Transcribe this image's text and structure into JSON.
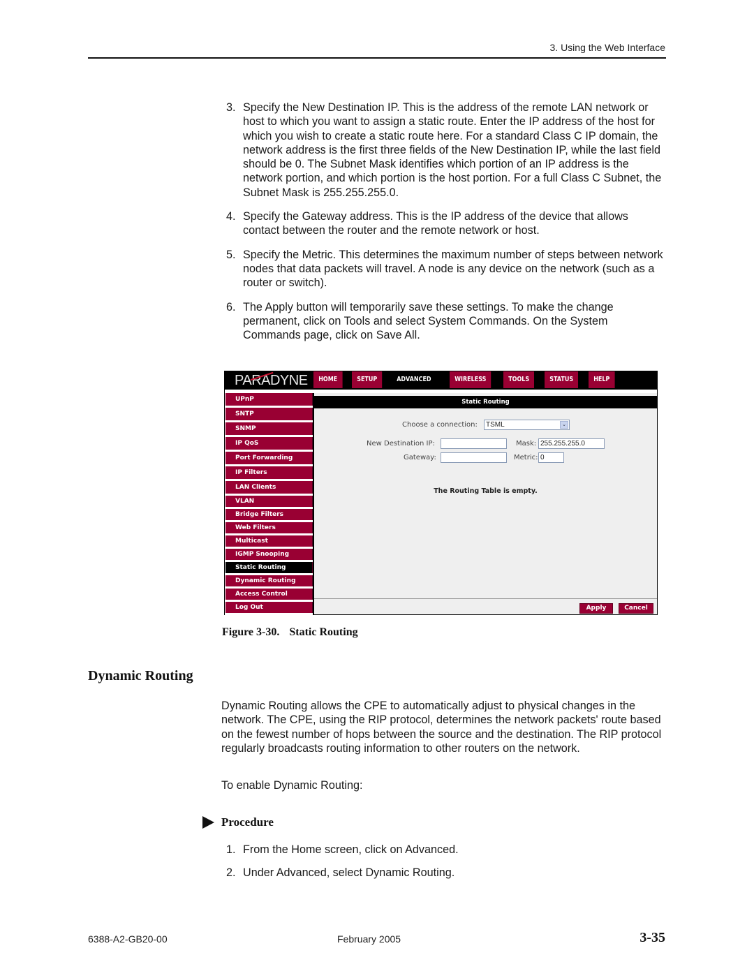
{
  "header": {
    "running_head": "3. Using the Web Interface"
  },
  "steps_top": [
    {
      "num": "3.",
      "text": "Specify the New Destination IP. This is the address of the remote LAN network or host to which you want to assign a static route. Enter the IP address of the host for which you wish to create a static route here. For a standard Class C IP domain, the network address is the first three fields of the New Destination IP, while the last field should be 0. The Subnet Mask identifies which portion of an IP address is the network portion, and which portion is the host portion. For a full Class C Subnet, the Subnet Mask is 255.255.255.0."
    },
    {
      "num": "4.",
      "text": "Specify the Gateway address. This is the IP address of the device that allows contact between the router and the remote network or host."
    },
    {
      "num": "5.",
      "text": "Specify the Metric. This determines the maximum number of steps between network nodes that data packets will travel. A node is any device on the network (such as a router or switch)."
    },
    {
      "num": "6.",
      "text": "The Apply button will temporarily save these settings. To make the change permanent, click on Tools and select System Commands. On the System Commands page, click on Save All."
    }
  ],
  "screenshot": {
    "logo": "PARADYNE",
    "tabs": [
      {
        "label": "HOME",
        "active": false
      },
      {
        "label": "SETUP",
        "active": false
      },
      {
        "label": "ADVANCED",
        "active": true
      },
      {
        "label": "WIRELESS",
        "active": false
      },
      {
        "label": "TOOLS",
        "active": false
      },
      {
        "label": "STATUS",
        "active": false
      },
      {
        "label": "HELP",
        "active": false
      }
    ],
    "sidebar": [
      {
        "label": "UPnP",
        "active": false
      },
      {
        "label": "SNTP",
        "active": false
      },
      {
        "label": "SNMP",
        "active": false
      },
      {
        "label": "IP QoS",
        "active": false
      },
      {
        "label": "Port Forwarding",
        "active": false
      },
      {
        "label": "IP Filters",
        "active": false
      },
      {
        "label": "LAN Clients",
        "active": false
      },
      {
        "label": "VLAN",
        "active": false
      },
      {
        "label": "Bridge Filters",
        "active": false
      },
      {
        "label": "Web Filters",
        "active": false
      },
      {
        "label": "Multicast",
        "active": false
      },
      {
        "label": "IGMP Snooping",
        "active": false
      },
      {
        "label": "Static Routing",
        "active": true
      },
      {
        "label": "Dynamic Routing",
        "active": false
      },
      {
        "label": "Access Control",
        "active": false
      },
      {
        "label": "Log Out",
        "active": false
      }
    ],
    "panel_title": "Static Routing",
    "connection_label": "Choose a connection:",
    "connection_value": "TSML",
    "dest_ip_label": "New Destination IP:",
    "dest_ip_value": "",
    "mask_label": "Mask:",
    "mask_value": "255.255.255.0",
    "gateway_label": "Gateway:",
    "gateway_value": "",
    "metric_label": "Metric:",
    "metric_value": "0",
    "empty_message": "The Routing Table is empty.",
    "apply_label": "Apply",
    "cancel_label": "Cancel",
    "colors": {
      "accent": "#990033",
      "bar": "#000000",
      "panel": "#efefef"
    }
  },
  "figure": {
    "number": "Figure 3-30.",
    "title": "Static Routing"
  },
  "section": {
    "heading": "Dynamic Routing",
    "paragraph": "Dynamic Routing allows the CPE to automatically adjust to physical changes in the network. The CPE, using the RIP protocol, determines the network packets' route based on the fewest number of hops between the source and the destination. The RIP protocol regularly broadcasts routing information to other routers on the network.",
    "enable_intro": "To enable Dynamic Routing:",
    "procedure_label": "Procedure",
    "procedure_steps": [
      {
        "num": "1.",
        "text": "From the Home screen, click on Advanced."
      },
      {
        "num": "2.",
        "text": "Under Advanced, select Dynamic Routing."
      }
    ]
  },
  "footer": {
    "doc_number": "6388-A2-GB20-00",
    "date": "February 2005",
    "page": "3-35"
  }
}
